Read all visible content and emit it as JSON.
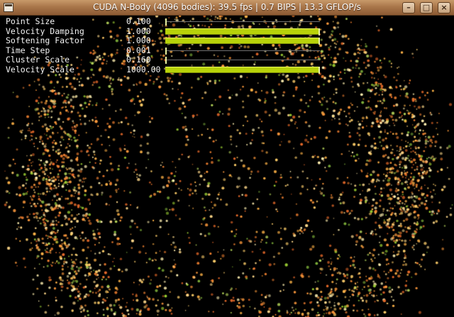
{
  "window": {
    "title": "CUDA N-Body (4096 bodies): 39.5 fps | 0.7 BIPS | 13.3 GFLOP/s",
    "icon": "app-window-icon",
    "controls": [
      {
        "name": "minimize-button",
        "glyph": "–"
      },
      {
        "name": "maximize-button",
        "glyph": "□"
      },
      {
        "name": "close-button",
        "glyph": "×"
      }
    ]
  },
  "params": [
    {
      "label": "Point Size",
      "value": "0.100",
      "fraction": 0.0
    },
    {
      "label": "Velocity Damping",
      "value": "1.000",
      "fraction": 1.0
    },
    {
      "label": "Softening Factor",
      "value": "1.000",
      "fraction": 1.0
    },
    {
      "label": "Time Step",
      "value": "0.001",
      "fraction": 0.0
    },
    {
      "label": "Cluster Scale",
      "value": "0.160",
      "fraction": 0.0
    },
    {
      "label": "Velocity Scale",
      "value": "1000.00",
      "fraction": 1.0
    }
  ],
  "colors": {
    "background": "#000000",
    "slider_fill": "#b8d20a",
    "particle_warm": "#ffb347",
    "particle_green": "#9acd32"
  },
  "simulation": {
    "bodies": 4096
  }
}
